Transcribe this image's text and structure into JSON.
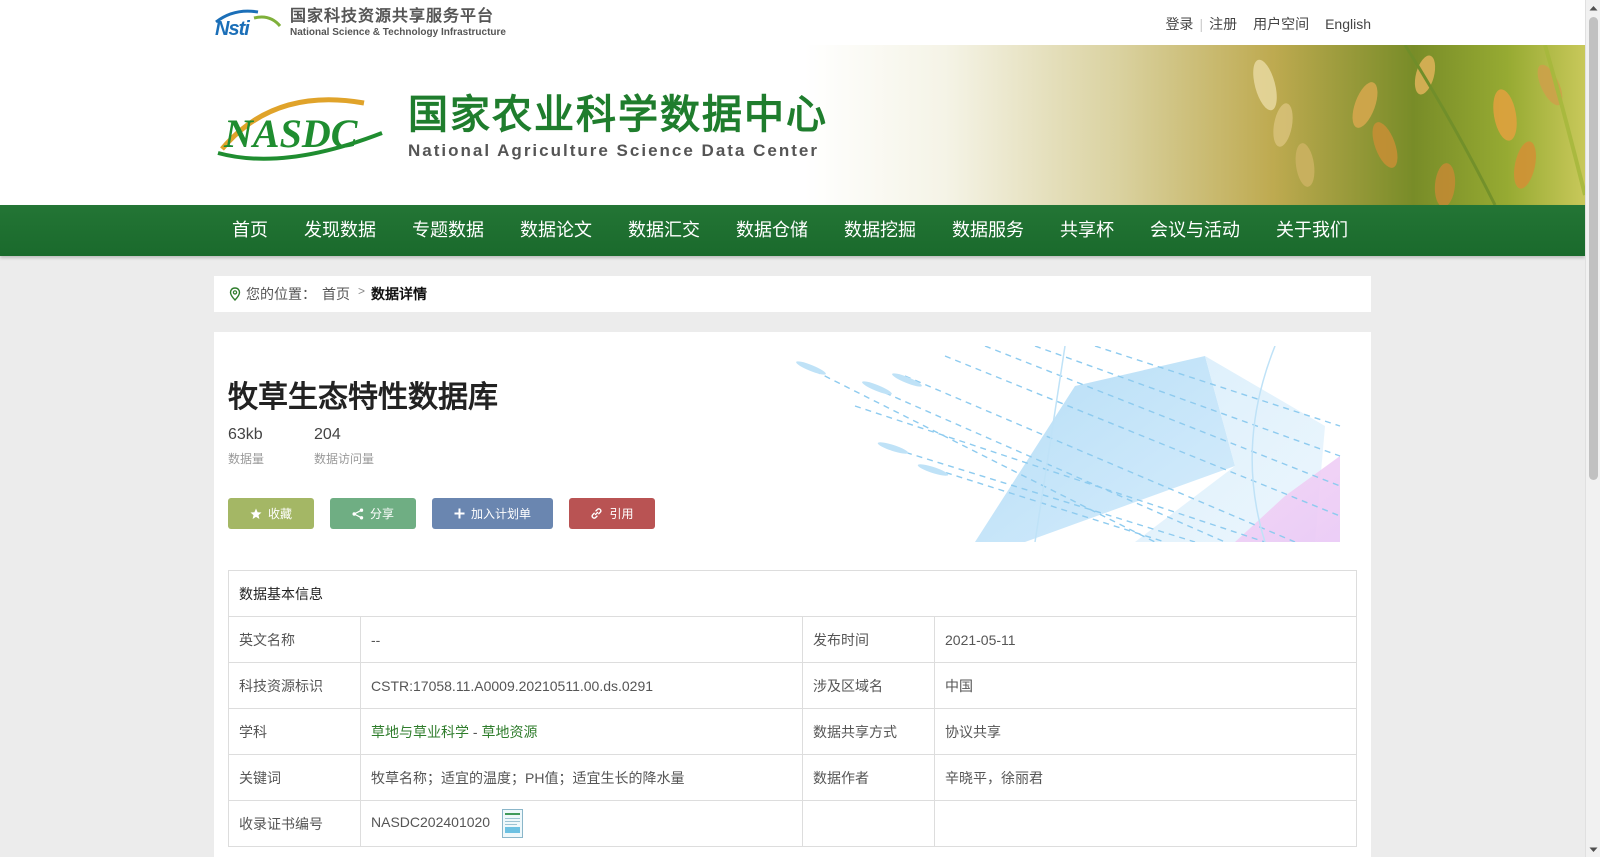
{
  "top": {
    "brand_cn": "国家科技资源共享服务平台",
    "brand_en": "National Science & Technology Infrastructure",
    "login": "登录",
    "register": "注册",
    "user_space": "用户空间",
    "english": "English"
  },
  "banner": {
    "title_cn": "国家农业科学数据中心",
    "title_en": "National Agriculture Science Data Center"
  },
  "nav": [
    "首页",
    "发现数据",
    "专题数据",
    "数据论文",
    "数据汇交",
    "数据仓储",
    "数据挖掘",
    "数据服务",
    "共享杯",
    "会议与活动",
    "关于我们"
  ],
  "breadcrumb": {
    "label": "您的位置：",
    "home": "首页",
    "arrow": ">",
    "current": "数据详情"
  },
  "dataset": {
    "title": "牧草生态特性数据库",
    "size_value": "63kb",
    "size_label": "数据量",
    "visits_value": "204",
    "visits_label": "数据访问量"
  },
  "actions": {
    "favorite": "收藏",
    "share": "分享",
    "add_plan": "加入计划单",
    "cite": "引用"
  },
  "info": {
    "heading": "数据基本信息",
    "rows": [
      {
        "k1": "英文名称",
        "v1": "--",
        "k2": "发布时间",
        "v2": "2021-05-11"
      },
      {
        "k1": "科技资源标识",
        "v1": "CSTR:17058.11.A0009.20210511.00.ds.0291",
        "k2": "涉及区域名",
        "v2": "中国"
      },
      {
        "k1": "学科",
        "v1": "",
        "k2": "数据共享方式",
        "v2": "协议共享"
      },
      {
        "k1": "关键词",
        "v1": "牧草名称；适宜的温度；PH值；适宜生长的降水量",
        "k2": "数据作者",
        "v2": "辛晓平，徐丽君"
      },
      {
        "k1": "收录证书编号",
        "v1": "NASDC202401020",
        "k2": "",
        "v2": ""
      }
    ],
    "subject_main": "草地与草业科学",
    "subject_sep": "-",
    "subject_sub": "草地资源"
  },
  "colors": {
    "nav_green": "#1f7030",
    "brand_green": "#1f7d2d",
    "btn_favorite": "#a4b765",
    "btn_share": "#6fae83",
    "btn_plan": "#6a86b0",
    "btn_cite": "#b95353"
  }
}
